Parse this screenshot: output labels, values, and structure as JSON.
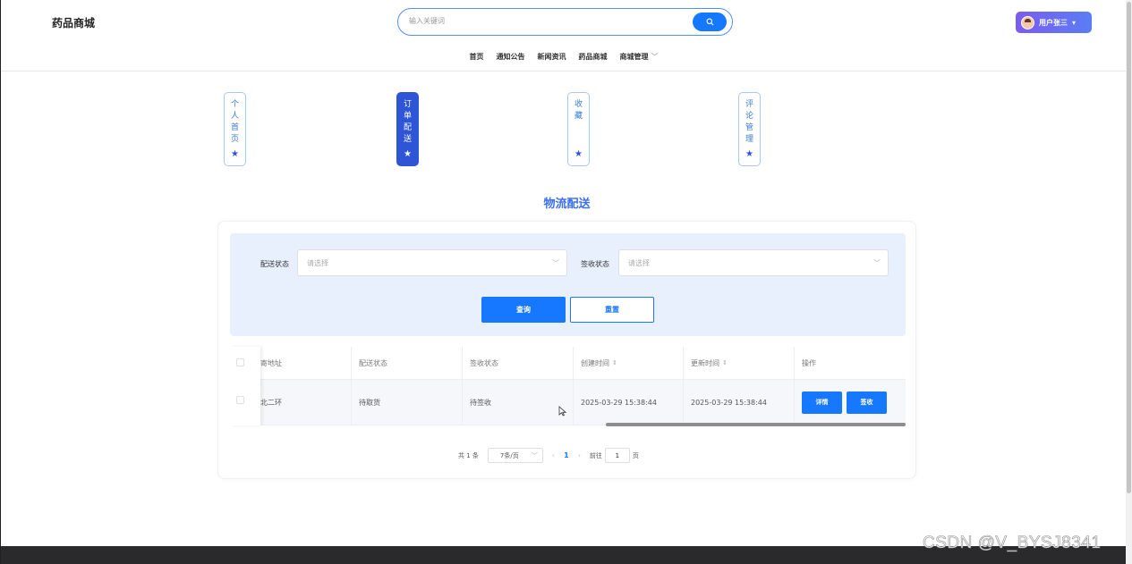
{
  "header": {
    "brand": "药品商城",
    "search_placeholder": "输入关键词",
    "user_label": "用户张三",
    "user_caret": "▾"
  },
  "nav": {
    "items": [
      "首页",
      "通知公告",
      "新闻资讯",
      "药品商城",
      "商城管理"
    ],
    "dropdown_caret": "﹀"
  },
  "side_tabs": [
    {
      "label": "个人首页",
      "active": false
    },
    {
      "label": "订单配送",
      "active": true
    },
    {
      "label": "收藏",
      "active": false
    },
    {
      "label": "评论管理",
      "active": false
    }
  ],
  "section_title": "物流配送",
  "filter": {
    "delivery_status_label": "配送状态",
    "delivery_status_placeholder": "请选择",
    "sign_status_label": "签收状态",
    "sign_status_placeholder": "请选择",
    "query_label": "查询",
    "reset_label": "重置"
  },
  "table": {
    "columns": [
      "寄地址",
      "配送状态",
      "签收状态",
      "创建时间",
      "更新时间",
      "操作"
    ],
    "sort_icon": "⇕",
    "rows": [
      {
        "address": "北二环",
        "delivery_status": "待取货",
        "sign_status": "待签收",
        "created_at": "2025-03-29 15:38:44",
        "updated_at": "2025-03-29 15:38:44",
        "actions": [
          "详情",
          "签收"
        ]
      }
    ]
  },
  "pagination": {
    "total_text": "共 1 条",
    "page_size": "7条/页",
    "prev": "‹",
    "current_page": "1",
    "next": "›",
    "goto_label": "前往",
    "goto_value": "1",
    "page_unit": "页"
  },
  "watermark": "CSDN @V_BYSJ8341",
  "colors": {
    "primary": "#1677ff",
    "active_tab": "#2d55d6",
    "title": "#3a6ff0",
    "filter_bg": "#e7f0fc"
  }
}
